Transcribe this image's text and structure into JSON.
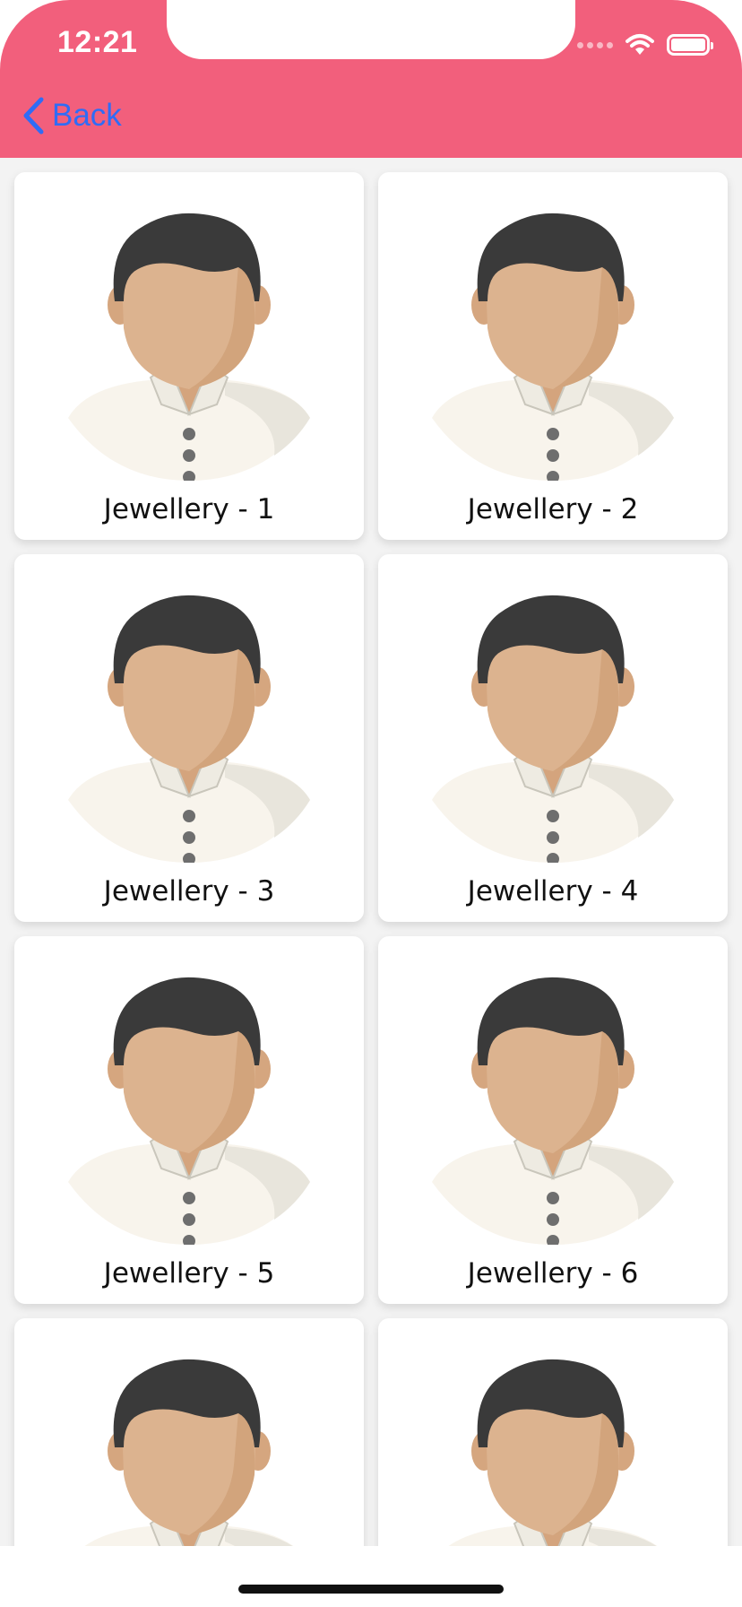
{
  "status_bar": {
    "time": "12:21",
    "icons": [
      "signal-icon",
      "wifi-icon",
      "battery-icon"
    ],
    "battery_level": 1.0
  },
  "nav": {
    "back_label": "Back",
    "back_icon": "chevron-left-icon"
  },
  "colors": {
    "header": "#f25f7c",
    "back_link": "#2f6cf6",
    "card_background": "#ffffff",
    "content_background": "#f3f3f3"
  },
  "items": [
    {
      "label": "Jewellery - 1",
      "image": "avatar-icon"
    },
    {
      "label": "Jewellery - 2",
      "image": "avatar-icon"
    },
    {
      "label": "Jewellery - 3",
      "image": "avatar-icon"
    },
    {
      "label": "Jewellery - 4",
      "image": "avatar-icon"
    },
    {
      "label": "Jewellery - 5",
      "image": "avatar-icon"
    },
    {
      "label": "Jewellery - 6",
      "image": "avatar-icon"
    },
    {
      "label": "",
      "image": "avatar-icon"
    },
    {
      "label": "",
      "image": "avatar-icon"
    }
  ]
}
